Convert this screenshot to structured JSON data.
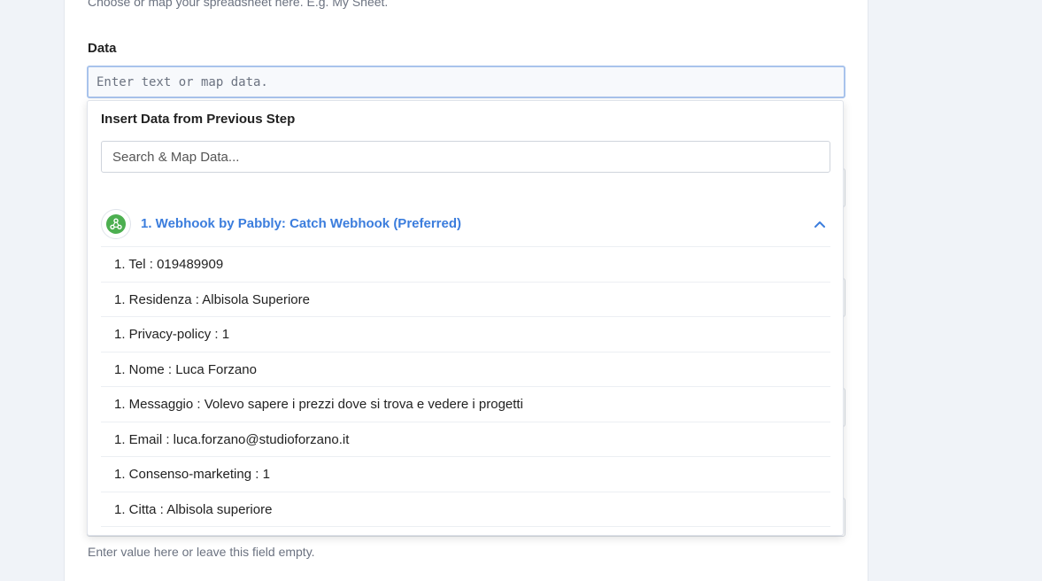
{
  "form": {
    "spreadsheet_hint": "Choose or map your spreadsheet here. E.g. My Sheet.",
    "data_label": "Data",
    "data_placeholder": "Enter text or map data.",
    "bottom_hint": "Enter value here or leave this field empty."
  },
  "dropdown": {
    "title": "Insert Data from Previous Step",
    "search_placeholder": "Search & Map Data...",
    "step": {
      "label": "1. Webhook by Pabbly: Catch Webhook (Preferred)",
      "icon": "webhook-icon",
      "expanded_icon": "chevron-up-icon"
    },
    "items": [
      "1. Tel : 019489909",
      "1. Residenza : Albisola Superiore",
      "1. Privacy-policy : 1",
      "1. Nome : Luca Forzano",
      "1. Messaggio : Volevo sapere i prezzi dove si trova e vedere i progetti",
      "1. Email : luca.forzano@studioforzano.it",
      "1. Consenso-marketing : 1",
      "1. Citta : Albisola superiore"
    ]
  },
  "colors": {
    "accent": "#3b7ddd",
    "webhook_green": "#4caf50",
    "input_focus_border": "#a8c3ec",
    "page_bg": "#f0f3f8"
  }
}
